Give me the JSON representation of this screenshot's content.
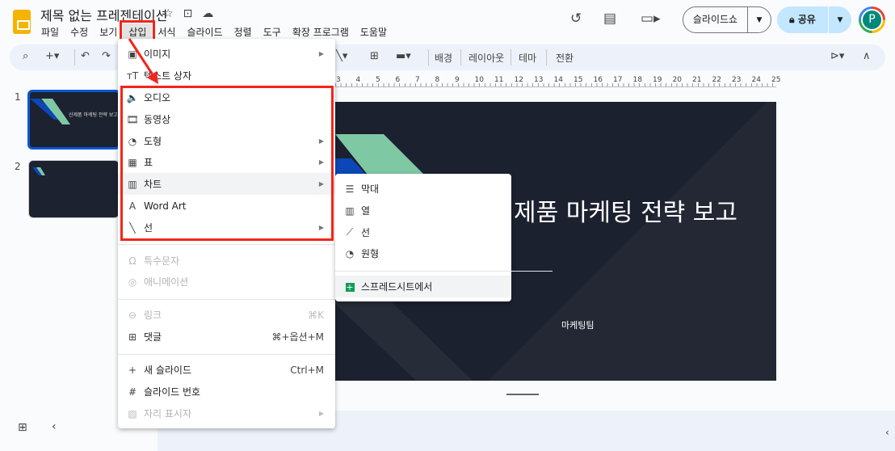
{
  "app": {
    "title": "제목 없는 프레젠테이션",
    "icons": [
      "star-icon",
      "move-to-folder-icon",
      "cloud-saved-icon"
    ]
  },
  "menubar": [
    "파일",
    "수정",
    "보기",
    "삽입",
    "서식",
    "슬라이드",
    "정렬",
    "도구",
    "확장 프로그램",
    "도움말"
  ],
  "header": {
    "slideshow": "슬라이드쇼",
    "share": "공유",
    "avatar": "P"
  },
  "toolbar": {
    "background": "배경",
    "layout": "레이아웃",
    "theme": "테마",
    "transition": "전환"
  },
  "ruler": [
    "3",
    "4",
    "5",
    "6",
    "7",
    "8",
    "9",
    "10",
    "11",
    "12",
    "13",
    "14",
    "15",
    "16",
    "17",
    "18",
    "19",
    "20",
    "21",
    "22",
    "23",
    "24",
    "25"
  ],
  "filmstrip": [
    {
      "num": "1",
      "title": "신제품 마케팅 전략 보고"
    },
    {
      "num": "2"
    }
  ],
  "slide": {
    "title": "신제품 마케팅 전략 보고",
    "subtitle": "마케팅팀"
  },
  "insert_menu": [
    {
      "icon": "image-icon",
      "glyph": "▣",
      "label": "이미지",
      "arrow": true
    },
    {
      "icon": "text-box-icon",
      "glyph": "ᴛT",
      "label": "텍스트 상자"
    },
    {
      "icon": "audio-icon",
      "glyph": "🔈",
      "label": "오디오"
    },
    {
      "icon": "video-icon",
      "glyph": "🎞",
      "label": "동영상"
    },
    {
      "icon": "shape-icon",
      "glyph": "◔",
      "label": "도형",
      "arrow": true
    },
    {
      "icon": "table-icon",
      "glyph": "▦",
      "label": "표",
      "arrow": true
    },
    {
      "icon": "chart-icon",
      "glyph": "▥",
      "label": "차트",
      "arrow": true,
      "highlight": true
    },
    {
      "icon": "word-art-icon",
      "glyph": "A",
      "label": "Word Art"
    },
    {
      "icon": "line-icon",
      "glyph": "╲",
      "label": "선",
      "arrow": true
    },
    {
      "icon": "special-chars-icon",
      "glyph": "Ω",
      "label": "특수문자",
      "disabled": true
    },
    {
      "icon": "animation-icon",
      "glyph": "◎",
      "label": "애니메이션",
      "disabled": true
    },
    {
      "icon": "link-icon",
      "glyph": "⊖",
      "label": "링크",
      "shortcut": "⌘K",
      "disabled": true
    },
    {
      "icon": "comment-icon",
      "glyph": "⊞",
      "label": "댓글",
      "shortcut": "⌘+옵션+M"
    },
    {
      "icon": "plus-icon",
      "glyph": "+",
      "label": "새 슬라이드",
      "shortcut": "Ctrl+M"
    },
    {
      "icon": "hash-icon",
      "glyph": "#",
      "label": "슬라이드 번호"
    },
    {
      "icon": "placeholder-icon",
      "glyph": "▨",
      "label": "자리 표시자",
      "arrow": true,
      "disabled": true
    }
  ],
  "chart_submenu": [
    {
      "icon": "bar-chart-icon",
      "glyph": "☰",
      "label": "막대"
    },
    {
      "icon": "column-chart-icon",
      "glyph": "▥",
      "label": "열"
    },
    {
      "icon": "line-chart-icon",
      "glyph": "⟋",
      "label": "선"
    },
    {
      "icon": "pie-chart-icon",
      "glyph": "◔",
      "label": "원형"
    },
    {
      "icon": "sheets-icon",
      "glyph": "+",
      "label": "스프레드시트에서",
      "highlight": true
    }
  ],
  "colors": {
    "highlight_box": "#f2261a",
    "sheets_green": "#0f9d58",
    "share_bg": "#c2e7ff",
    "slide_bg": "#1c2130",
    "accent_green": "#7fc8a4",
    "accent_blue": "#0b47b8"
  }
}
